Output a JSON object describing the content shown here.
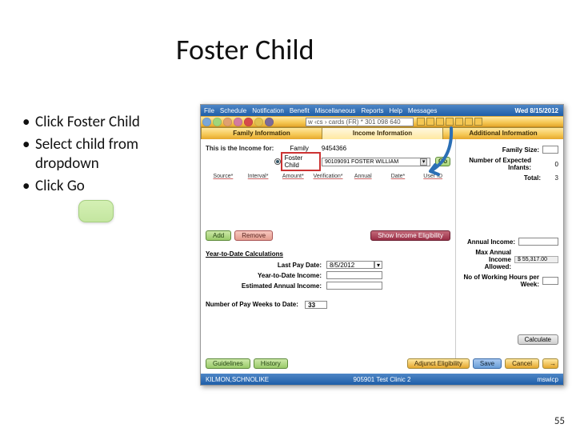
{
  "title": "Foster Child",
  "bullets": [
    "Click Foster Child",
    "Select child from dropdown",
    "Click  Go"
  ],
  "menubar": {
    "items": [
      "File",
      "Schedule",
      "Notification",
      "Benefit",
      "Miscellaneous",
      "Reports",
      "Help",
      "Messages"
    ],
    "date": "Wed 8/15/2012"
  },
  "searchbar": {
    "text": "w ‹cs › cards (FR) * 301 098 640"
  },
  "tabs": {
    "left": "Family Information",
    "center": "Income Information",
    "right": "Additional Information"
  },
  "income": {
    "this_is_label": "This is the Income for:",
    "family_label": "Family",
    "family_num": "9454366",
    "foster_label": "Foster Child",
    "foster_value": "90109091 FOSTER WILLIAM",
    "go": "Go",
    "grid": [
      "Source*",
      "Interval*",
      "Amount*",
      "Verification*",
      "Annual",
      "Date*",
      "User ID"
    ],
    "add": "Add",
    "remove": "Remove",
    "show_elig": "Show Income Eligibility"
  },
  "ytd": {
    "title": "Year-to-Date Calculations",
    "last_pay": "Last Pay Date:",
    "last_pay_val": "8/5/2012",
    "ytd_income": "Year-to-Date Income:",
    "est_annual": "Estimated Annual Income:",
    "pay_weeks": "Number of Pay Weeks to Date:",
    "pay_weeks_val": "33"
  },
  "right": {
    "family_size": "Family Size:",
    "expected": "Number of Expected Infants:",
    "expected_val": "0",
    "total": "Total:",
    "total_val": "3",
    "annual_income": "Annual Income:",
    "max_allowed": "Max Annual Income Allowed:",
    "max_allowed_val": "$ 55,317.00",
    "hours": "No of Working Hours per Week:",
    "calculate": "Calculate"
  },
  "footer": {
    "guidelines": "Guidelines",
    "history": "History",
    "adjunct": "Adjunct Eligibility",
    "save": "Save",
    "cancel": "Cancel",
    "next": "→"
  },
  "status": {
    "left": "KILMON,SCHNOLIKE",
    "mid": "905901 Test Clinic 2",
    "right": "mswicp"
  },
  "page_number": "55"
}
